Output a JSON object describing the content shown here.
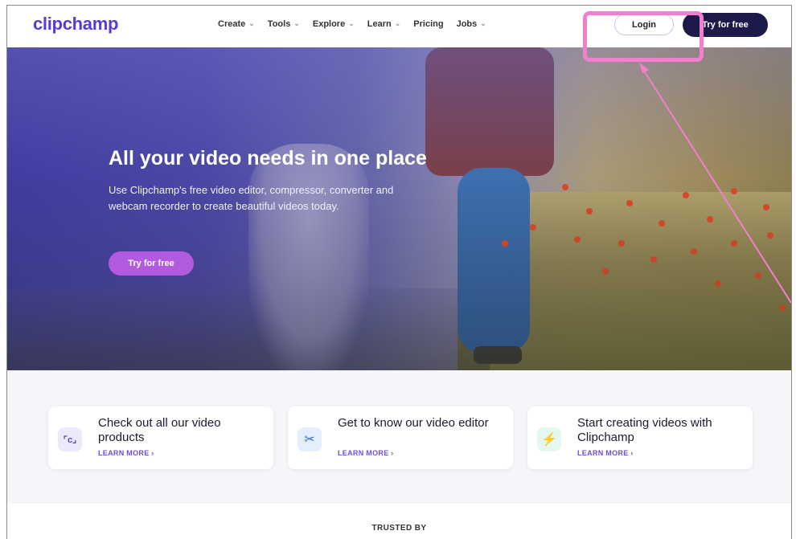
{
  "brand": {
    "logo_text": "clipchamp",
    "accent": "#5a3ad6"
  },
  "nav": {
    "items": [
      {
        "label": "Create",
        "has_dropdown": true
      },
      {
        "label": "Tools",
        "has_dropdown": true
      },
      {
        "label": "Explore",
        "has_dropdown": true
      },
      {
        "label": "Learn",
        "has_dropdown": true
      },
      {
        "label": "Pricing",
        "has_dropdown": false
      },
      {
        "label": "Jobs",
        "has_dropdown": true
      }
    ],
    "dropdown_icon": "chevron-down-icon",
    "login_label": "Login",
    "try_label": "Try for free",
    "highlight_color": "#f47fd1"
  },
  "hero": {
    "title": "All your video needs in one place",
    "subtitle": "Use Clipchamp's free video editor, compressor, converter and webcam recorder to create beautiful videos today.",
    "cta_label": "Try for free",
    "cta_color": "#b25ae0"
  },
  "cards": [
    {
      "icon": "crop-frame-icon",
      "icon_glyph": "⌜c⌟",
      "icon_bg": "#ece9fb",
      "icon_color": "#5a3ad6",
      "title": "Check out all our video products",
      "link": "LEARN MORE ›"
    },
    {
      "icon": "scissors-icon",
      "icon_glyph": "✂",
      "icon_bg": "#e4effd",
      "icon_color": "#2b6ad8",
      "title": "Get to know our video editor",
      "link": "LEARN MORE ›"
    },
    {
      "icon": "lightning-icon",
      "icon_glyph": "⚡",
      "icon_bg": "#e4f8ee",
      "icon_color": "#22a06b",
      "title": "Start creating videos with Clipchamp",
      "link": "LEARN MORE ›"
    }
  ],
  "trusted_label": "TRUSTED BY"
}
